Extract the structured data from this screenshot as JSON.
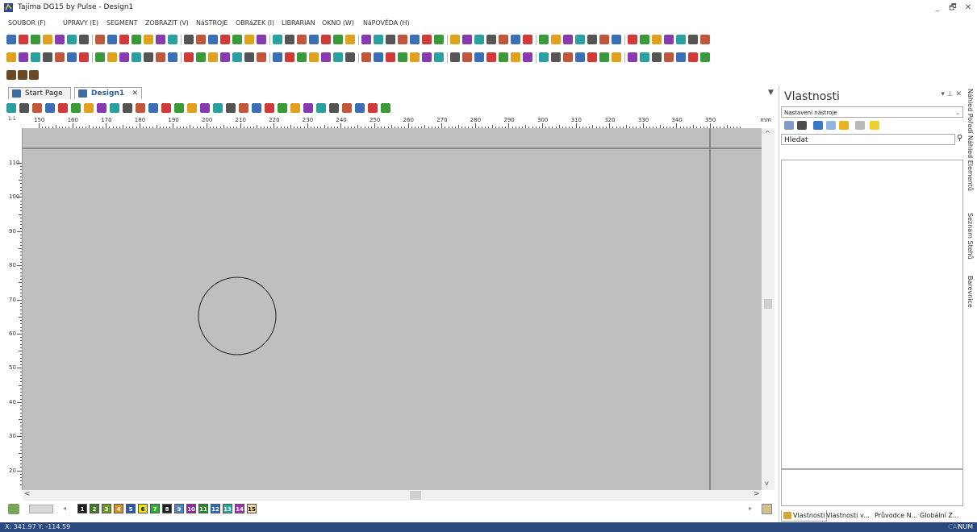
{
  "window": {
    "title": "Tajima DG15 by Pulse - Design1",
    "minimize": "_",
    "maximize": "🗗",
    "close": "✕"
  },
  "menu": [
    "SOUBOR (F)",
    "ÚPRAVY (E)",
    "SEGMENT",
    "ZOBRAZIT (V)",
    "NáSTROJE",
    "OBRáZEK (I)",
    "LIBRARIAN",
    "OKNO (W)",
    "NáPOVĚDA (H)"
  ],
  "tabs": {
    "start_page": "Start Page",
    "design1": "Design1",
    "close": "✕"
  },
  "ruler": {
    "corner": "1:1",
    "unit": "mm",
    "top_labels": [
      "150",
      "160",
      "170",
      "180",
      "190",
      "200",
      "210",
      "220",
      "230",
      "240",
      "250",
      "260",
      "270",
      "280",
      "290",
      "300",
      "310",
      "320",
      "330",
      "340",
      "350"
    ],
    "left_labels": [
      "110",
      "100",
      "90",
      "80",
      "70",
      "60",
      "50",
      "40",
      "30",
      "20"
    ]
  },
  "palette": {
    "swatches": [
      {
        "n": "1",
        "c": "#1a1a1a",
        "t": "#ffffff"
      },
      {
        "n": "2",
        "c": "#3c7a27",
        "t": "#ffffff"
      },
      {
        "n": "3",
        "c": "#6e9a23",
        "t": "#ffffff"
      },
      {
        "n": "4",
        "c": "#d39228",
        "t": "#ffffff"
      },
      {
        "n": "5",
        "c": "#2a56b5",
        "t": "#ffffff"
      },
      {
        "n": "6",
        "c": "#f0e20f",
        "t": "#000000"
      },
      {
        "n": "7",
        "c": "#2fae2f",
        "t": "#ffffff"
      },
      {
        "n": "8",
        "c": "#202020",
        "t": "#ffffff"
      },
      {
        "n": "9",
        "c": "#4b87c2",
        "t": "#ffffff"
      },
      {
        "n": "10",
        "c": "#9124a8",
        "t": "#ffffff"
      },
      {
        "n": "11",
        "c": "#2a8a2a",
        "t": "#ffffff"
      },
      {
        "n": "12",
        "c": "#2a6fb7",
        "t": "#ffffff"
      },
      {
        "n": "13",
        "c": "#2aa7a0",
        "t": "#ffffff"
      },
      {
        "n": "14",
        "c": "#a230b5",
        "t": "#ffffff"
      },
      {
        "n": "15",
        "c": "#f1d89a",
        "t": "#000000"
      }
    ]
  },
  "status": {
    "coords": "X: 341.97 Y: -114.59",
    "caps": "CAP",
    "num": "NUM"
  },
  "properties": {
    "title": "Vlastnosti",
    "buttons": "▾ ⊥ ✕",
    "combo": "Nastavení nástroje",
    "search": "Hledat",
    "tabs": [
      "Vlastnosti",
      "Vlastnosti v...",
      "Průvodce N...",
      "Globální Z..."
    ]
  },
  "side_tabs": [
    "Náhled Pořadí",
    "Náhled Elementů",
    "Seznam Stehů",
    "Barevnice"
  ]
}
